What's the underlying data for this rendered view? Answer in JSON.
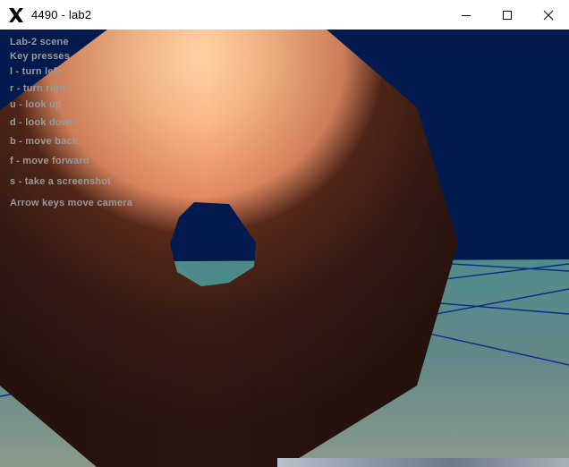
{
  "window": {
    "title": "4490 - lab2",
    "icon": "x-app-icon",
    "controls": [
      "minimize-icon",
      "maximize-icon",
      "close-icon"
    ]
  },
  "overlay": {
    "lines": [
      "Lab-2 scene",
      "Key presses",
      "l - turn left",
      "r - turn right",
      "u - look up",
      "d - look down",
      "b - move back",
      "f - move forward",
      "s - take a screenshot",
      "Arrow keys move camera"
    ]
  },
  "scene": {
    "sky_color": "#021a4d",
    "floor_color": "#5e8a82",
    "grid_color": "#0b2a8c"
  }
}
